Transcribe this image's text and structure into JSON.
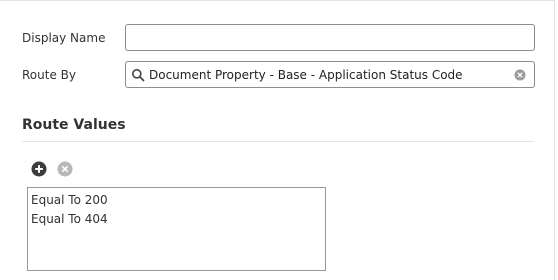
{
  "form": {
    "display_name_label": "Display Name",
    "display_name_value": "",
    "route_by_label": "Route By",
    "route_by_value": "Document Property - Base - Application Status Code"
  },
  "route_values": {
    "title": "Route Values",
    "items": [
      {
        "label": "Equal To 200"
      },
      {
        "label": "Equal To 404"
      }
    ]
  },
  "icons": {
    "search": "search-icon",
    "clear": "clear-icon",
    "add": "add-icon",
    "remove": "remove-icon"
  },
  "colors": {
    "add_icon": "#3c3c3c",
    "remove_icon": "#b8b8b8",
    "field_border": "#8e8e8e"
  }
}
